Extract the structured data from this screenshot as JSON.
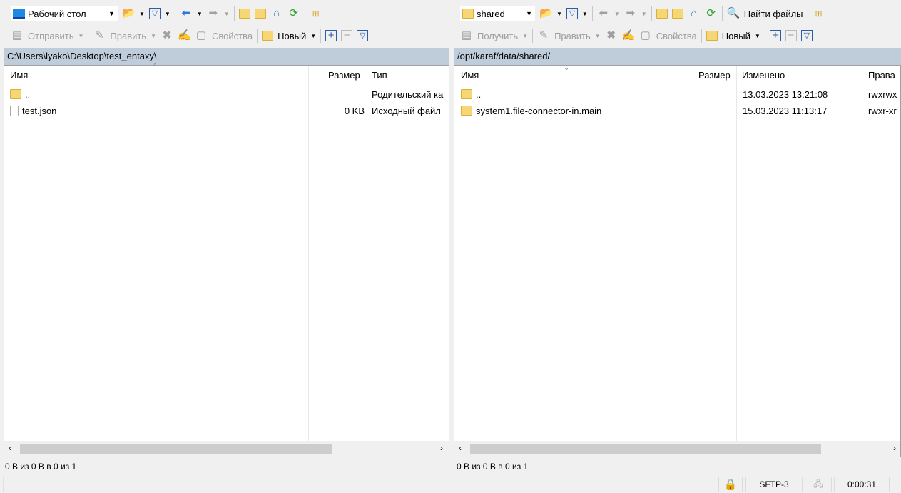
{
  "left": {
    "location": "Рабочий стол",
    "send_label": "Отправить",
    "edit_label": "Править",
    "properties_label": "Свойства",
    "new_label": "Новый",
    "path": "C:\\Users\\lyako\\Desktop\\test_entaxy\\",
    "columns": [
      "Имя",
      "Размер",
      "Тип"
    ],
    "rows": [
      {
        "name": "..",
        "size": "",
        "type": "Родительский ка"
      },
      {
        "name": "test.json",
        "size": "0 KB",
        "type": "Исходный файл"
      }
    ],
    "status": "0 B из 0 B в 0 из 1"
  },
  "right": {
    "location": "shared",
    "find_label": "Найти файлы",
    "receive_label": "Получить",
    "edit_label": "Править",
    "properties_label": "Свойства",
    "new_label": "Новый",
    "path": "/opt/karaf/data/shared/",
    "columns": [
      "Имя",
      "Размер",
      "Изменено",
      "Права"
    ],
    "rows": [
      {
        "name": "..",
        "size": "",
        "modified": "13.03.2023 13:21:08",
        "rights": "rwxrwx"
      },
      {
        "name": "system1.file-connector-in.main",
        "size": "",
        "modified": "15.03.2023 11:13:17",
        "rights": "rwxr-xr"
      }
    ],
    "status": "0 B из 0 B в 0 из 1"
  },
  "statusbar": {
    "protocol": "SFTP-3",
    "time": "0:00:31"
  }
}
